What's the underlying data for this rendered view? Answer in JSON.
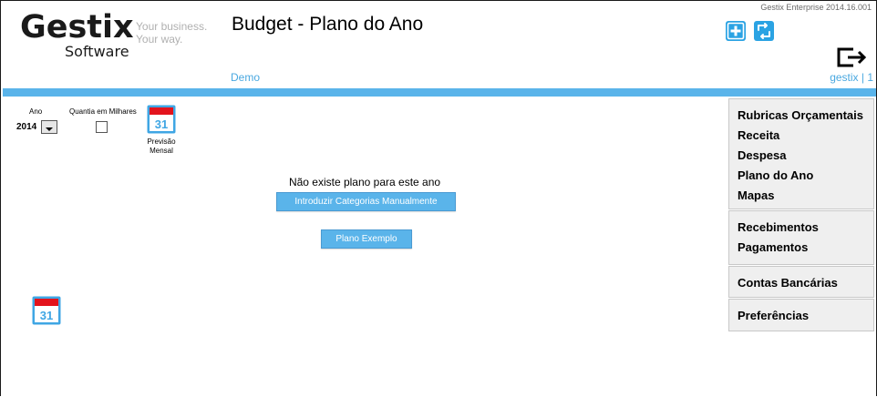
{
  "header": {
    "logo_word": "Gestix",
    "logo_sub": "Software",
    "slogan_line1": "Your business.",
    "slogan_line2": "Your way.",
    "page_title": "Budget - Plano do Ano",
    "version": "Gestix Enterprise 2014.16.001",
    "company": "Demo",
    "user": "gestix | 1",
    "icons": [
      "plus-square-icon",
      "refresh-icon",
      "logout-icon"
    ]
  },
  "filters": {
    "ano_label": "Ano",
    "ano_value": "2014",
    "milhares_label": "Quantia em Milhares",
    "milhares_checked": false
  },
  "calendar": {
    "day": "31",
    "previsao_line1": "Previsão",
    "previsao_line2": "Mensal"
  },
  "main": {
    "message": "Não existe plano para este ano",
    "btn_manual": "Introduzir Categorias Manualmente",
    "btn_exemplo": "Plano Exemplo"
  },
  "side_menu": {
    "group1": [
      "Rubricas Orçamentais",
      "Receita",
      "Despesa",
      "Plano do Ano",
      "Mapas"
    ],
    "group2": [
      "Recebimentos",
      "Pagamentos"
    ],
    "group3": [
      "Contas Bancárias"
    ],
    "group4": [
      "Preferências"
    ]
  },
  "colors": {
    "accent": "#5ab4ea",
    "link": "#4aa8e0",
    "calendar_red": "#e3141d",
    "menu_bg": "#efefef"
  }
}
